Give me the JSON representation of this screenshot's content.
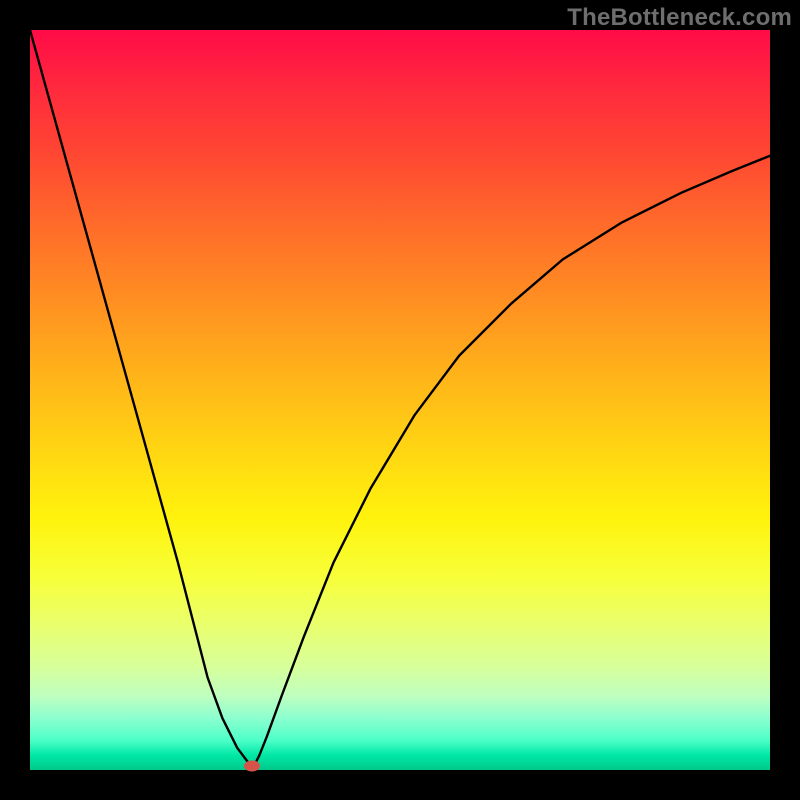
{
  "watermark": "TheBottleneck.com",
  "chart_data": {
    "type": "line",
    "title": "",
    "xlabel": "",
    "ylabel": "",
    "xlim": [
      0,
      100
    ],
    "ylim": [
      0,
      100
    ],
    "series": [
      {
        "name": "curve",
        "x": [
          0,
          5,
          10,
          15,
          20,
          24,
          26,
          28,
          29.5,
          30,
          30.5,
          31,
          32,
          34,
          37,
          41,
          46,
          52,
          58,
          65,
          72,
          80,
          88,
          95,
          100
        ],
        "y": [
          100,
          82,
          64,
          46,
          28,
          12.5,
          7,
          3,
          1,
          0.5,
          1,
          2,
          4.5,
          10,
          18,
          28,
          38,
          48,
          56,
          63,
          69,
          74,
          78,
          81,
          83
        ]
      }
    ],
    "marker": {
      "x": 30,
      "y": 0.5,
      "color": "#d6534a"
    },
    "background_gradient": {
      "top": "#ff0b47",
      "bottom": "#00c98a"
    }
  }
}
